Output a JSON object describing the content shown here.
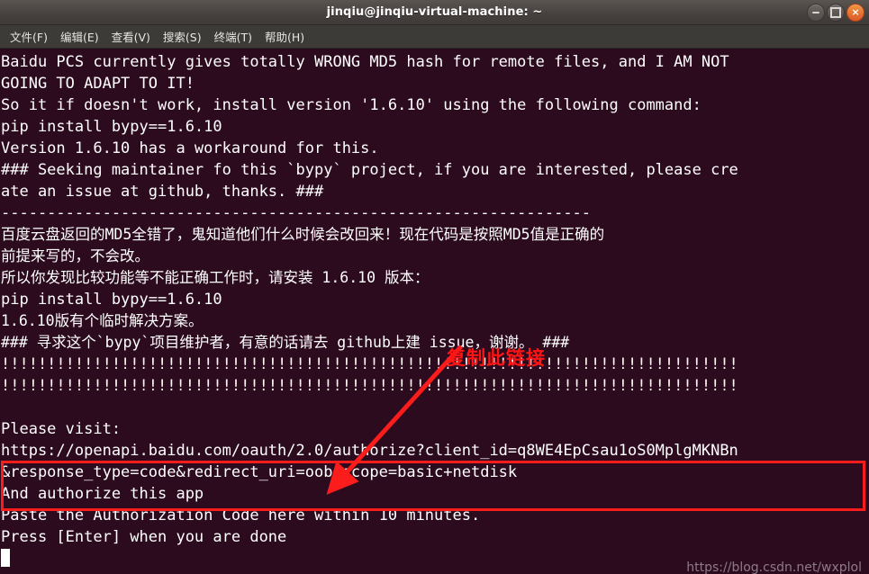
{
  "window": {
    "title": "jinqiu@jinqiu-virtual-machine: ~",
    "controls": {
      "minimize_label": "minimize",
      "maximize_label": "maximize",
      "close_label": "×"
    }
  },
  "menubar": {
    "items": [
      {
        "label": "文件(F)"
      },
      {
        "label": "编辑(E)"
      },
      {
        "label": "查看(V)"
      },
      {
        "label": "搜索(S)"
      },
      {
        "label": "终端(T)"
      },
      {
        "label": "帮助(H)"
      }
    ]
  },
  "terminal": {
    "lines": [
      {
        "text": "Baidu PCS currently gives totally WRONG MD5 hash for remote files, and I AM NOT",
        "style": "plain"
      },
      {
        "text": "GOING TO ADAPT TO IT!",
        "style": "plain"
      },
      {
        "text": "So it if doesn't work, install version '1.6.10' using the following command:",
        "style": "plain"
      },
      {
        "text": "pip install bypy==1.6.10",
        "style": "plain"
      },
      {
        "text": "Version 1.6.10 has a workaround for this.",
        "style": "plain"
      },
      {
        "text": "### Seeking maintainer fo this `bypy` project, if you are interested, please cre",
        "style": "plain"
      },
      {
        "text": "ate an issue at github, thanks. ###",
        "style": "plain"
      },
      {
        "text": "----------------------------------------------------------------",
        "style": "plain"
      },
      {
        "text": "百度云盘返回的MD5全错了，鬼知道他们什么时候会改回来！现在代码是按照MD5值是正确的",
        "style": "cn"
      },
      {
        "text": "前提来写的，不会改。",
        "style": "cn"
      },
      {
        "text": "所以你发现比较功能等不能正确工作时，请安装 1.6.10 版本：",
        "style": "cn"
      },
      {
        "text": "pip install bypy==1.6.10",
        "style": "plain"
      },
      {
        "text": "1.6.10版有个临时解决方案。",
        "style": "cn"
      },
      {
        "text": "### 寻求这个`bypy`项目维护者，有意的话请去 github上建 issue，谢谢。 ###",
        "style": "cn"
      },
      {
        "text": "!!!!!!!!!!!!!!!!!!!!!!!!!!!!!!!!!!!!!!!!!!!!!!!!!!!!!!!!!!!!!!!!!!!!!!!!!!!!!!!!",
        "style": "bang"
      },
      {
        "text": "!!!!!!!!!!!!!!!!!!!!!!!!!!!!!!!!!!!!!!!!!!!!!!!!!!!!!!!!!!!!!!!!!!!!!!!!!!!!!!!!",
        "style": "bang"
      },
      {
        "text": "",
        "style": "blank"
      },
      {
        "text": "Please visit:",
        "style": "plain"
      },
      {
        "text": "https://openapi.baidu.com/oauth/2.0/authorize?client_id=q8WE4EpCsau1oS0MplgMKNBn",
        "style": "plain"
      },
      {
        "text": "&response_type=code&redirect_uri=oob&scope=basic+netdisk",
        "style": "plain"
      },
      {
        "text": "And authorize this app",
        "style": "plain"
      },
      {
        "text": "Paste the Authorization Code here within 10 minutes.",
        "style": "plain"
      },
      {
        "text": "Press [Enter] when you are done",
        "style": "plain"
      }
    ]
  },
  "annotations": {
    "copy_link_label": "复制此链接",
    "arrow_color": "#fb1c1c",
    "box_color": "#fb1c1c"
  },
  "watermark": {
    "text": "https://blog.csdn.net/wxplol"
  },
  "colors": {
    "terminal_bg": "#2d0b1f",
    "terminal_fg": "#ffffff",
    "titlebar_bg": "#474140",
    "menubar_bg": "#3c3b37",
    "accent_red": "#fb1c1c",
    "close_button": "#dc5a26"
  }
}
